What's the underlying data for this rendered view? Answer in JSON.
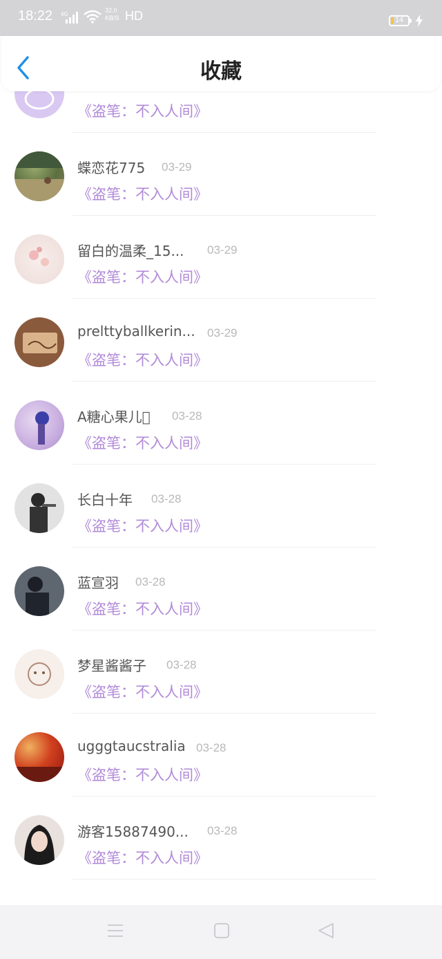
{
  "status_bar": {
    "time": "18:22",
    "network": "4G",
    "speed_value": "32.0",
    "speed_unit": "KB/S",
    "hd": "HD",
    "battery": "14"
  },
  "header": {
    "title": "收藏",
    "back_icon": "chevron-left-icon"
  },
  "items": [
    {
      "name": "",
      "date": "",
      "book": "《盗笔：不入人间》",
      "avatar_color": "#d9c8f2"
    },
    {
      "name": "蝶恋花775",
      "date": "03-29",
      "book": "《盗笔：不入人间》",
      "avatar_color": "#6b7d4e"
    },
    {
      "name": "留白的温柔_15...",
      "date": "03-29",
      "book": "《盗笔：不入人间》",
      "avatar_color": "#f3e6e4"
    },
    {
      "name": "prelttyballkerin...",
      "date": "03-29",
      "book": "《盗笔：不入人间》",
      "avatar_color": "#a0704e"
    },
    {
      "name": "A糖心果儿\u0000",
      "date": "03-28",
      "book": "《盗笔：不入人间》",
      "avatar_color": "#b9a0d8"
    },
    {
      "name": "长白十年",
      "date": "03-28",
      "book": "《盗笔：不入人间》",
      "avatar_color": "#cfcfcf"
    },
    {
      "name": "蓝宣羽",
      "date": "03-28",
      "book": "《盗笔：不入人间》",
      "avatar_color": "#3d4550"
    },
    {
      "name": "梦星酱酱子",
      "date": "03-28",
      "book": "《盗笔：不入人间》",
      "avatar_color": "#efe3dd"
    },
    {
      "name": "ugggtaucstralia",
      "date": "03-28",
      "book": "《盗笔：不入人间》",
      "avatar_color": "#c22418"
    },
    {
      "name": "游客15887490...",
      "date": "03-28",
      "book": "《盗笔：不入人间》",
      "avatar_color": "#e8d9d4"
    }
  ],
  "nav": {
    "menu_icon": "menu-icon",
    "home_icon": "home-square-icon",
    "back_icon": "back-triangle-icon"
  },
  "colors": {
    "accent_blue": "#1e90e6",
    "book_purple": "#b18ad8"
  }
}
